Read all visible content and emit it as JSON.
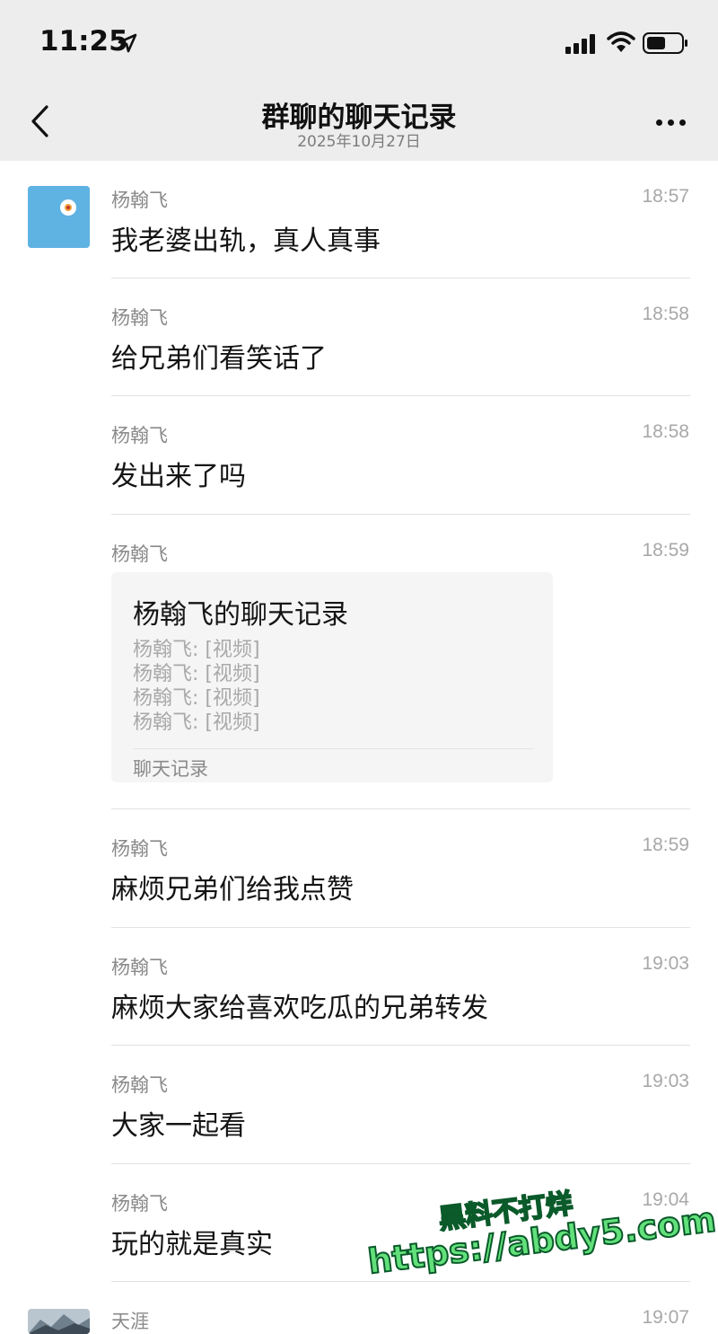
{
  "status_bar": {
    "time": "11:25"
  },
  "nav": {
    "title": "群聊的聊天记录",
    "subtitle": "2025年10月27日"
  },
  "messages": [
    {
      "sender": "杨翰飞",
      "time": "18:57",
      "text": "我老婆出轨，真人真事"
    },
    {
      "sender": "杨翰飞",
      "time": "18:58",
      "text": "给兄弟们看笑话了"
    },
    {
      "sender": "杨翰飞",
      "time": "18:58",
      "text": "发出来了吗"
    },
    {
      "sender": "杨翰飞",
      "time": "18:59",
      "card": {
        "title": "杨翰飞的聊天记录",
        "lines": [
          "杨翰飞: [视频]",
          "杨翰飞: [视频]",
          "杨翰飞: [视频]",
          "杨翰飞: [视频]"
        ],
        "footer": "聊天记录"
      }
    },
    {
      "sender": "杨翰飞",
      "time": "18:59",
      "text": "麻烦兄弟们给我点赞"
    },
    {
      "sender": "杨翰飞",
      "time": "19:03",
      "text": "麻烦大家给喜欢吃瓜的兄弟转发"
    },
    {
      "sender": "杨翰飞",
      "time": "19:03",
      "text": "大家一起看"
    },
    {
      "sender": "杨翰飞",
      "time": "19:04",
      "text": "玩的就是真实"
    },
    {
      "sender": "天涯",
      "time": "19:07",
      "text": ""
    }
  ],
  "watermark": {
    "line1": "黑料不打烊",
    "line2": "https://abdy5.com"
  },
  "colors": {
    "header_bg": "#ededed",
    "avatar1_bg": "#5fb3e2"
  }
}
